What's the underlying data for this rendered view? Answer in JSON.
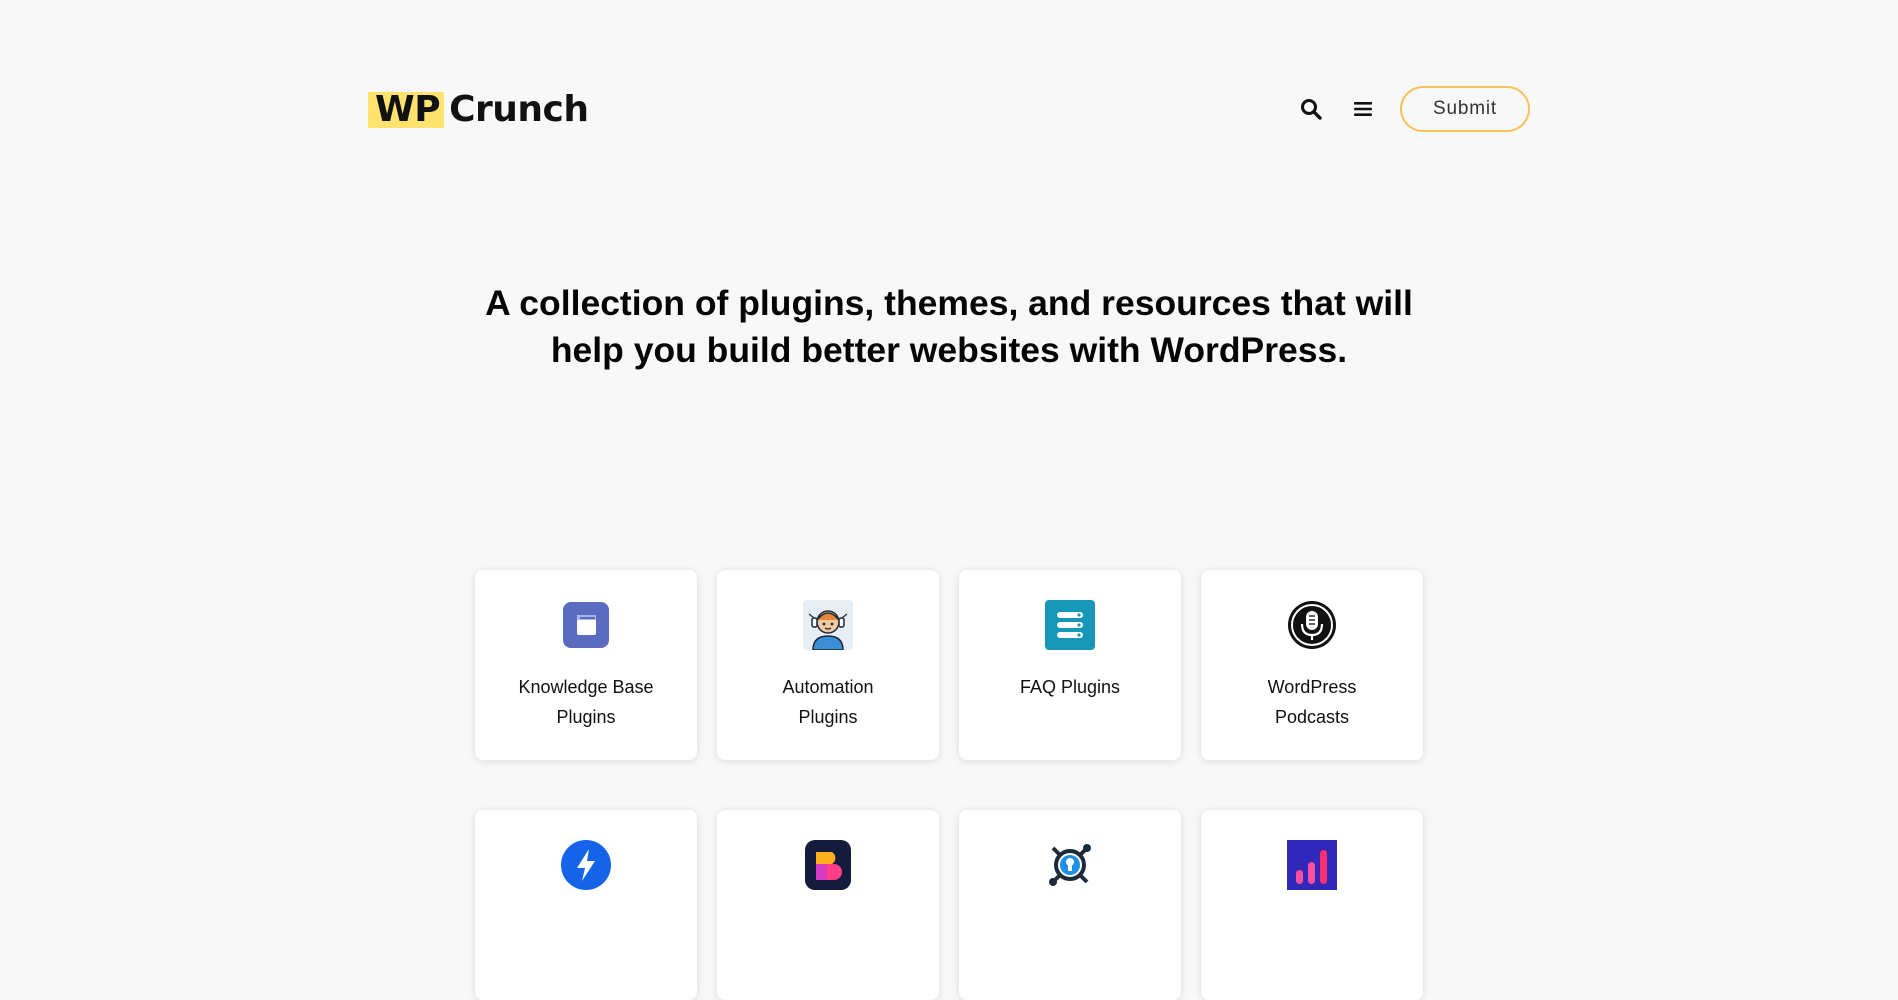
{
  "header": {
    "logo": {
      "prefix": "WP",
      "suffix": "Crunch"
    },
    "search_icon": "search-icon",
    "menu_icon": "hamburger-menu-icon",
    "submit_label": "Submit"
  },
  "hero": {
    "line1": "A collection of plugins, themes, and resources that will",
    "line2": "help you build better websites with WordPress."
  },
  "colors": {
    "background": "#f8f8f8",
    "logo_highlight": "#ffe36e",
    "submit_border": "#f5c35a",
    "card_background": "#ffffff"
  },
  "cards": [
    {
      "label": "Knowledge Base Plugins",
      "icon": "book-icon"
    },
    {
      "label": "Automation Plugins",
      "icon": "robot-astronaut-icon"
    },
    {
      "label": "FAQ Plugins",
      "icon": "list-toggle-icon"
    },
    {
      "label": "WordPress Podcasts",
      "icon": "microphone-icon"
    },
    {
      "label": "",
      "icon": "lightning-bolt-icon"
    },
    {
      "label": "",
      "icon": "b-logo-icon"
    },
    {
      "label": "",
      "icon": "keyhole-network-icon"
    },
    {
      "label": "",
      "icon": "bar-chart-icon"
    }
  ]
}
